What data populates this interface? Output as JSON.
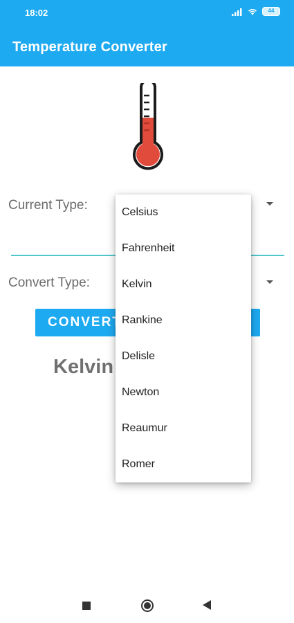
{
  "status_bar": {
    "time": "18:02",
    "battery": "44"
  },
  "app_bar": {
    "title": "Temperature Converter"
  },
  "form": {
    "current_type_label": "Current Type:",
    "convert_type_label": "Convert Type:",
    "convert_button": "CONVERT",
    "result_text": "Kelvin"
  },
  "dropdown": {
    "options": [
      "Celsius",
      "Fahrenheit",
      "Kelvin",
      "Rankine",
      "Delisle",
      "Newton",
      "Reaumur",
      "Romer"
    ]
  },
  "colors": {
    "primary": "#1eaaf1",
    "accent": "#4fc6c9",
    "thermometer_red": "#e14b3b"
  }
}
